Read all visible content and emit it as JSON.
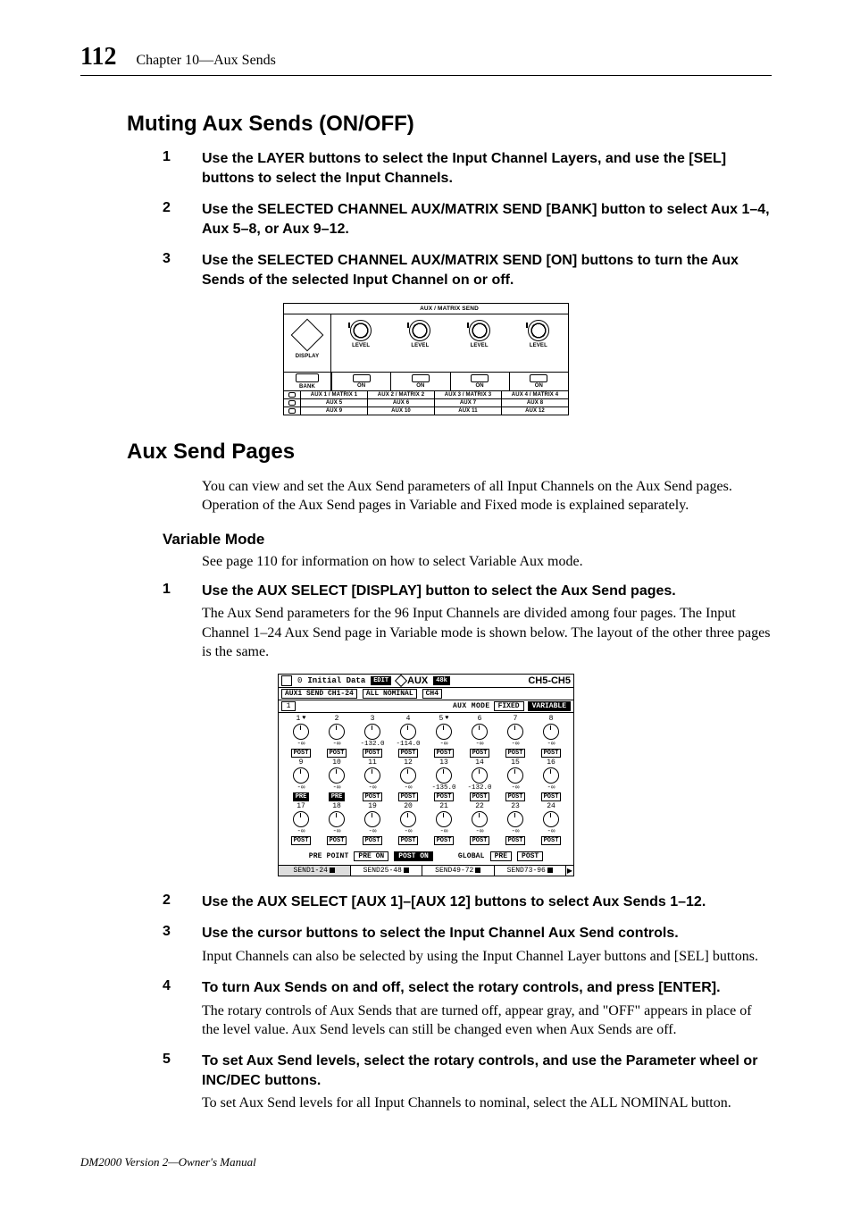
{
  "page": {
    "number": "112",
    "chapter": "Chapter 10—Aux Sends",
    "footer": "DM2000 Version 2—Owner's Manual"
  },
  "s1": {
    "heading": "Muting Aux Sends (ON/OFF)",
    "steps": [
      {
        "n": "1",
        "title": "Use the LAYER buttons to select the Input Channel Layers, and use the [SEL] buttons to select the Input Channels."
      },
      {
        "n": "2",
        "title": "Use the SELECTED CHANNEL AUX/MATRIX SEND [BANK] button to select Aux 1–4, Aux 5–8, or Aux 9–12."
      },
      {
        "n": "3",
        "title": "Use the SELECTED CHANNEL AUX/MATRIX SEND [ON] buttons to turn the Aux Sends of the selected Input Channel on or off."
      }
    ]
  },
  "hw_panel": {
    "title": "AUX / MATRIX SEND",
    "display": "DISPLAY",
    "level": "LEVEL",
    "bank": "BANK",
    "on": "ON",
    "rows": [
      [
        "AUX 1 / MATRIX 1",
        "AUX 2 / MATRIX 2",
        "AUX 3 / MATRIX 3",
        "AUX 4 / MATRIX 4"
      ],
      [
        "AUX 5",
        "AUX 6",
        "AUX 7",
        "AUX 8"
      ],
      [
        "AUX 9",
        "AUX 10",
        "AUX 11",
        "AUX 12"
      ]
    ]
  },
  "s2": {
    "heading": "Aux Send Pages",
    "intro": "You can view and set the Aux Send parameters of all Input Channels on the Aux Send pages. Operation of the Aux Send pages in Variable and Fixed mode is explained separately.",
    "subhead": "Variable Mode",
    "subdesc": "See page 110 for information on how to select Variable Aux mode.",
    "steps": [
      {
        "n": "1",
        "title": "Use the AUX SELECT [DISPLAY] button to select the Aux Send pages.",
        "desc": "The Aux Send parameters for the 96 Input Channels are divided among four pages. The Input Channel 1–24 Aux Send page in Variable mode is shown below. The layout of the other three pages is the same."
      },
      {
        "n": "2",
        "title": "Use the AUX SELECT [AUX 1]–[AUX 12] buttons to select Aux Sends 1–12."
      },
      {
        "n": "3",
        "title": "Use the cursor buttons to select the Input Channel Aux Send controls.",
        "desc": "Input Channels can also be selected by using the Input Channel Layer buttons and [SEL] buttons."
      },
      {
        "n": "4",
        "title": "To turn Aux Sends on and off, select the rotary controls, and press [ENTER].",
        "desc": "The rotary controls of Aux Sends that are turned off, appear gray, and \"OFF\" appears in place of the level value. Aux Send levels can still be changed even when Aux Sends are off."
      },
      {
        "n": "5",
        "title": "To set Aux Send levels, select the rotary controls, and use the Parameter wheel or INC/DEC buttons.",
        "desc": "To set Aux Send levels for all Input Channels to nominal, select the ALL NOMINAL button."
      }
    ]
  },
  "lcd": {
    "top": {
      "scene_icon_label": "0",
      "scene_title": "Initial Data",
      "edit_badge": "EDIT",
      "aux_title": "AUX",
      "sample_badge": "48k",
      "channel": "CH5-CH5"
    },
    "row2": {
      "left": "AUX1  SEND CH1-24",
      "all_nominal": "ALL NOMINAL",
      "ch_box": "CH4"
    },
    "row3": {
      "one": "1",
      "mode_label": "AUX MODE",
      "fixed": "FIXED",
      "variable": "VARIABLE"
    },
    "knobs": [
      [
        {
          "n": "1",
          "val": "-∞",
          "pp": "POST",
          "heart": true
        },
        {
          "n": "2",
          "val": "-∞",
          "pp": "POST"
        },
        {
          "n": "3",
          "val": "-132.0",
          "pp": "POST"
        },
        {
          "n": "4",
          "val": "-114.0",
          "pp": "POST"
        },
        {
          "n": "5",
          "val": "-∞",
          "pp": "POST",
          "heart": true
        },
        {
          "n": "6",
          "val": "-∞",
          "pp": "POST"
        },
        {
          "n": "7",
          "val": "-∞",
          "pp": "POST"
        },
        {
          "n": "8",
          "val": "-∞",
          "pp": "POST"
        }
      ],
      [
        {
          "n": "9",
          "val": "-∞",
          "pp": "PRE",
          "inv": true
        },
        {
          "n": "10",
          "val": "-∞",
          "pp": "PRE",
          "inv": true
        },
        {
          "n": "11",
          "val": "-∞",
          "pp": "POST"
        },
        {
          "n": "12",
          "val": "-∞",
          "pp": "POST"
        },
        {
          "n": "13",
          "val": "-135.0",
          "pp": "POST"
        },
        {
          "n": "14",
          "val": "-132.0",
          "pp": "POST"
        },
        {
          "n": "15",
          "val": "-∞",
          "pp": "POST"
        },
        {
          "n": "16",
          "val": "-∞",
          "pp": "POST"
        }
      ],
      [
        {
          "n": "17",
          "val": "-∞",
          "pp": "POST"
        },
        {
          "n": "18",
          "val": "-∞",
          "pp": "POST"
        },
        {
          "n": "19",
          "val": "-∞",
          "pp": "POST"
        },
        {
          "n": "20",
          "val": "-∞",
          "pp": "POST"
        },
        {
          "n": "21",
          "val": "-∞",
          "pp": "POST"
        },
        {
          "n": "22",
          "val": "-∞",
          "pp": "POST"
        },
        {
          "n": "23",
          "val": "-∞",
          "pp": "POST"
        },
        {
          "n": "24",
          "val": "-∞",
          "pp": "POST"
        }
      ]
    ],
    "bottom": {
      "pre_point": "PRE POINT",
      "pre_on": "PRE ON",
      "post_on": "POST ON",
      "global": "GLOBAL",
      "pre": "PRE",
      "post": "POST"
    },
    "tabs": [
      "SEND1-24",
      "SEND25-48",
      "SEND49-72",
      "SEND73-96"
    ]
  }
}
